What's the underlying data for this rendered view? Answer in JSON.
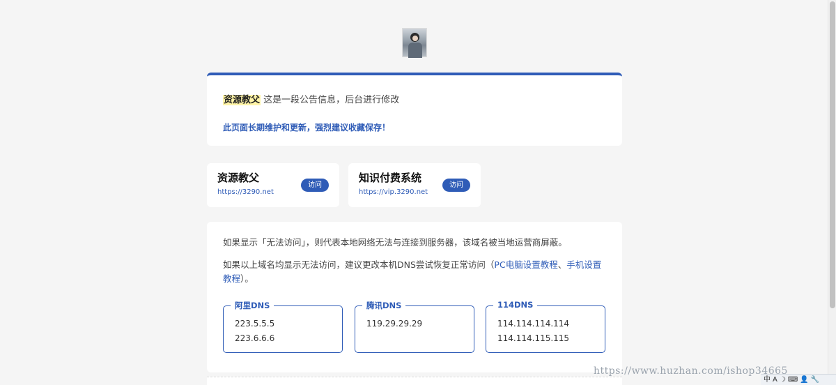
{
  "notice": {
    "tag": "资源教父",
    "text": " 这是一段公告信息，后台进行修改",
    "highlight": "此页面长期维护和更新，强烈建议收藏保存！"
  },
  "sites": [
    {
      "name": "资源教父",
      "url": "https://3290.net",
      "button": "访问"
    },
    {
      "name": "知识付费系统",
      "url": "https://vip.3290.net",
      "button": "访问"
    }
  ],
  "info": {
    "p1": "如果显示「无法访问」，则代表本地网络无法与连接到服务器，该域名被当地运营商屏蔽。",
    "p2_prefix": "如果以上域名均显示无法访问，建议更改本机DNS尝试恢复正常访问（",
    "pc_link": "PC电脑设置教程",
    "sep": "、",
    "mobile_link": "手机设置教程",
    "p2_suffix": "）。"
  },
  "dns": [
    {
      "label": "阿里DNS",
      "ips": [
        "223.5.5.5",
        "223.6.6.6"
      ]
    },
    {
      "label": "腾讯DNS",
      "ips": [
        "119.29.29.29",
        ""
      ]
    },
    {
      "label": "114DNS",
      "ips": [
        "114.114.114.114",
        "114.114.115.115"
      ]
    }
  ],
  "watermark": "https://www.huzhan.com/ishop34665",
  "tray": {
    "items": [
      "中",
      "A",
      "☽",
      "⌨",
      "👤",
      "🔧"
    ]
  }
}
